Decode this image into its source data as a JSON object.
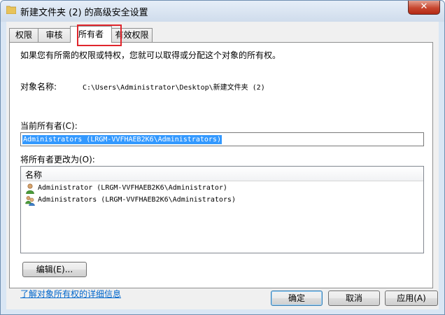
{
  "window": {
    "title": "新建文件夹 (2) 的高级安全设置",
    "close_label": "✕"
  },
  "tabs": [
    {
      "label": "权限"
    },
    {
      "label": "审核"
    },
    {
      "label": "所有者"
    },
    {
      "label": "有效权限"
    }
  ],
  "owner_tab": {
    "intro": "如果您有所需的权限或特权，您就可以取得或分配这个对象的所有权。",
    "object_name_label": "对象名称:",
    "object_name_value": "C:\\Users\\Administrator\\Desktop\\新建文件夹 (2)",
    "current_owner_label": "当前所有者(C):",
    "current_owner_value": "Administrators (LRGM-VVFHAEB2K6\\Administrators)",
    "change_owner_label": "将所有者更改为(O):",
    "list_header": "名称",
    "list_items": [
      {
        "name": "Administrator (LRGM-VVFHAEB2K6\\Administrator)",
        "icon": "single-user-icon"
      },
      {
        "name": "Administrators (LRGM-VVFHAEB2K6\\Administrators)",
        "icon": "user-group-icon"
      }
    ],
    "edit_button": "编辑(E)...",
    "learn_more_link": "了解对象所有权的详细信息"
  },
  "footer": {
    "ok_button": "确定",
    "cancel_button": "取消",
    "apply_button": "应用(A)"
  },
  "colors": {
    "accent": "#0066cc",
    "selection": "#3399ff",
    "tab_highlight": "#e0262d"
  }
}
